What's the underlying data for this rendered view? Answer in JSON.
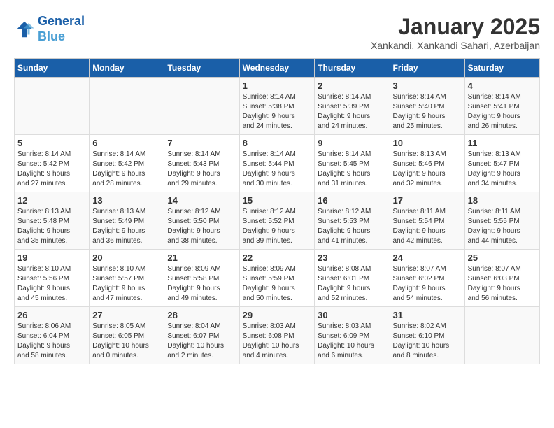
{
  "logo": {
    "line1": "General",
    "line2": "Blue"
  },
  "title": "January 2025",
  "subtitle": "Xankandi, Xankandi Sahari, Azerbaijan",
  "headers": [
    "Sunday",
    "Monday",
    "Tuesday",
    "Wednesday",
    "Thursday",
    "Friday",
    "Saturday"
  ],
  "weeks": [
    [
      {
        "day": "",
        "info": ""
      },
      {
        "day": "",
        "info": ""
      },
      {
        "day": "",
        "info": ""
      },
      {
        "day": "1",
        "info": "Sunrise: 8:14 AM\nSunset: 5:38 PM\nDaylight: 9 hours\nand 24 minutes."
      },
      {
        "day": "2",
        "info": "Sunrise: 8:14 AM\nSunset: 5:39 PM\nDaylight: 9 hours\nand 24 minutes."
      },
      {
        "day": "3",
        "info": "Sunrise: 8:14 AM\nSunset: 5:40 PM\nDaylight: 9 hours\nand 25 minutes."
      },
      {
        "day": "4",
        "info": "Sunrise: 8:14 AM\nSunset: 5:41 PM\nDaylight: 9 hours\nand 26 minutes."
      }
    ],
    [
      {
        "day": "5",
        "info": "Sunrise: 8:14 AM\nSunset: 5:42 PM\nDaylight: 9 hours\nand 27 minutes."
      },
      {
        "day": "6",
        "info": "Sunrise: 8:14 AM\nSunset: 5:42 PM\nDaylight: 9 hours\nand 28 minutes."
      },
      {
        "day": "7",
        "info": "Sunrise: 8:14 AM\nSunset: 5:43 PM\nDaylight: 9 hours\nand 29 minutes."
      },
      {
        "day": "8",
        "info": "Sunrise: 8:14 AM\nSunset: 5:44 PM\nDaylight: 9 hours\nand 30 minutes."
      },
      {
        "day": "9",
        "info": "Sunrise: 8:14 AM\nSunset: 5:45 PM\nDaylight: 9 hours\nand 31 minutes."
      },
      {
        "day": "10",
        "info": "Sunrise: 8:13 AM\nSunset: 5:46 PM\nDaylight: 9 hours\nand 32 minutes."
      },
      {
        "day": "11",
        "info": "Sunrise: 8:13 AM\nSunset: 5:47 PM\nDaylight: 9 hours\nand 34 minutes."
      }
    ],
    [
      {
        "day": "12",
        "info": "Sunrise: 8:13 AM\nSunset: 5:48 PM\nDaylight: 9 hours\nand 35 minutes."
      },
      {
        "day": "13",
        "info": "Sunrise: 8:13 AM\nSunset: 5:49 PM\nDaylight: 9 hours\nand 36 minutes."
      },
      {
        "day": "14",
        "info": "Sunrise: 8:12 AM\nSunset: 5:50 PM\nDaylight: 9 hours\nand 38 minutes."
      },
      {
        "day": "15",
        "info": "Sunrise: 8:12 AM\nSunset: 5:52 PM\nDaylight: 9 hours\nand 39 minutes."
      },
      {
        "day": "16",
        "info": "Sunrise: 8:12 AM\nSunset: 5:53 PM\nDaylight: 9 hours\nand 41 minutes."
      },
      {
        "day": "17",
        "info": "Sunrise: 8:11 AM\nSunset: 5:54 PM\nDaylight: 9 hours\nand 42 minutes."
      },
      {
        "day": "18",
        "info": "Sunrise: 8:11 AM\nSunset: 5:55 PM\nDaylight: 9 hours\nand 44 minutes."
      }
    ],
    [
      {
        "day": "19",
        "info": "Sunrise: 8:10 AM\nSunset: 5:56 PM\nDaylight: 9 hours\nand 45 minutes."
      },
      {
        "day": "20",
        "info": "Sunrise: 8:10 AM\nSunset: 5:57 PM\nDaylight: 9 hours\nand 47 minutes."
      },
      {
        "day": "21",
        "info": "Sunrise: 8:09 AM\nSunset: 5:58 PM\nDaylight: 9 hours\nand 49 minutes."
      },
      {
        "day": "22",
        "info": "Sunrise: 8:09 AM\nSunset: 5:59 PM\nDaylight: 9 hours\nand 50 minutes."
      },
      {
        "day": "23",
        "info": "Sunrise: 8:08 AM\nSunset: 6:01 PM\nDaylight: 9 hours\nand 52 minutes."
      },
      {
        "day": "24",
        "info": "Sunrise: 8:07 AM\nSunset: 6:02 PM\nDaylight: 9 hours\nand 54 minutes."
      },
      {
        "day": "25",
        "info": "Sunrise: 8:07 AM\nSunset: 6:03 PM\nDaylight: 9 hours\nand 56 minutes."
      }
    ],
    [
      {
        "day": "26",
        "info": "Sunrise: 8:06 AM\nSunset: 6:04 PM\nDaylight: 9 hours\nand 58 minutes."
      },
      {
        "day": "27",
        "info": "Sunrise: 8:05 AM\nSunset: 6:05 PM\nDaylight: 10 hours\nand 0 minutes."
      },
      {
        "day": "28",
        "info": "Sunrise: 8:04 AM\nSunset: 6:07 PM\nDaylight: 10 hours\nand 2 minutes."
      },
      {
        "day": "29",
        "info": "Sunrise: 8:03 AM\nSunset: 6:08 PM\nDaylight: 10 hours\nand 4 minutes."
      },
      {
        "day": "30",
        "info": "Sunrise: 8:03 AM\nSunset: 6:09 PM\nDaylight: 10 hours\nand 6 minutes."
      },
      {
        "day": "31",
        "info": "Sunrise: 8:02 AM\nSunset: 6:10 PM\nDaylight: 10 hours\nand 8 minutes."
      },
      {
        "day": "",
        "info": ""
      }
    ]
  ]
}
